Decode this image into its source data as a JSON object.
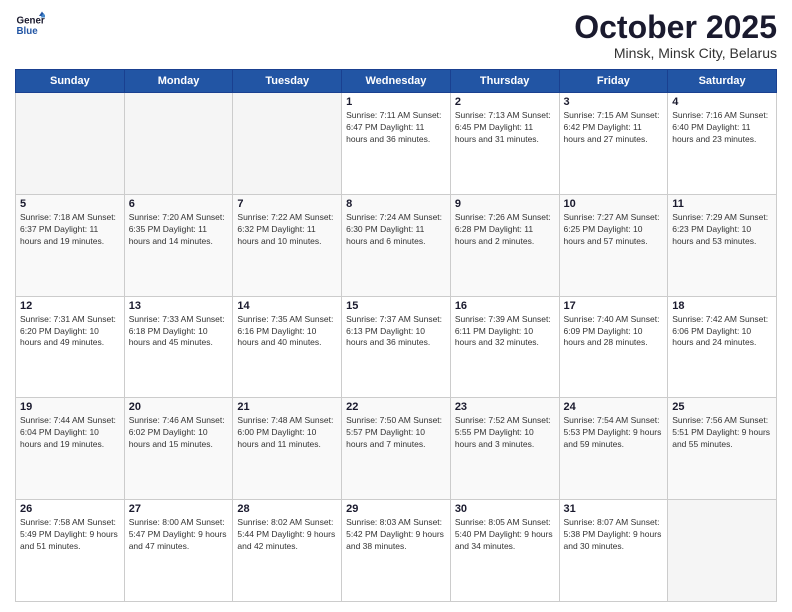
{
  "logo": {
    "line1": "General",
    "line2": "Blue"
  },
  "title": "October 2025",
  "location": "Minsk, Minsk City, Belarus",
  "days_of_week": [
    "Sunday",
    "Monday",
    "Tuesday",
    "Wednesday",
    "Thursday",
    "Friday",
    "Saturday"
  ],
  "weeks": [
    [
      {
        "day": "",
        "info": ""
      },
      {
        "day": "",
        "info": ""
      },
      {
        "day": "",
        "info": ""
      },
      {
        "day": "1",
        "info": "Sunrise: 7:11 AM\nSunset: 6:47 PM\nDaylight: 11 hours\nand 36 minutes."
      },
      {
        "day": "2",
        "info": "Sunrise: 7:13 AM\nSunset: 6:45 PM\nDaylight: 11 hours\nand 31 minutes."
      },
      {
        "day": "3",
        "info": "Sunrise: 7:15 AM\nSunset: 6:42 PM\nDaylight: 11 hours\nand 27 minutes."
      },
      {
        "day": "4",
        "info": "Sunrise: 7:16 AM\nSunset: 6:40 PM\nDaylight: 11 hours\nand 23 minutes."
      }
    ],
    [
      {
        "day": "5",
        "info": "Sunrise: 7:18 AM\nSunset: 6:37 PM\nDaylight: 11 hours\nand 19 minutes."
      },
      {
        "day": "6",
        "info": "Sunrise: 7:20 AM\nSunset: 6:35 PM\nDaylight: 11 hours\nand 14 minutes."
      },
      {
        "day": "7",
        "info": "Sunrise: 7:22 AM\nSunset: 6:32 PM\nDaylight: 11 hours\nand 10 minutes."
      },
      {
        "day": "8",
        "info": "Sunrise: 7:24 AM\nSunset: 6:30 PM\nDaylight: 11 hours\nand 6 minutes."
      },
      {
        "day": "9",
        "info": "Sunrise: 7:26 AM\nSunset: 6:28 PM\nDaylight: 11 hours\nand 2 minutes."
      },
      {
        "day": "10",
        "info": "Sunrise: 7:27 AM\nSunset: 6:25 PM\nDaylight: 10 hours\nand 57 minutes."
      },
      {
        "day": "11",
        "info": "Sunrise: 7:29 AM\nSunset: 6:23 PM\nDaylight: 10 hours\nand 53 minutes."
      }
    ],
    [
      {
        "day": "12",
        "info": "Sunrise: 7:31 AM\nSunset: 6:20 PM\nDaylight: 10 hours\nand 49 minutes."
      },
      {
        "day": "13",
        "info": "Sunrise: 7:33 AM\nSunset: 6:18 PM\nDaylight: 10 hours\nand 45 minutes."
      },
      {
        "day": "14",
        "info": "Sunrise: 7:35 AM\nSunset: 6:16 PM\nDaylight: 10 hours\nand 40 minutes."
      },
      {
        "day": "15",
        "info": "Sunrise: 7:37 AM\nSunset: 6:13 PM\nDaylight: 10 hours\nand 36 minutes."
      },
      {
        "day": "16",
        "info": "Sunrise: 7:39 AM\nSunset: 6:11 PM\nDaylight: 10 hours\nand 32 minutes."
      },
      {
        "day": "17",
        "info": "Sunrise: 7:40 AM\nSunset: 6:09 PM\nDaylight: 10 hours\nand 28 minutes."
      },
      {
        "day": "18",
        "info": "Sunrise: 7:42 AM\nSunset: 6:06 PM\nDaylight: 10 hours\nand 24 minutes."
      }
    ],
    [
      {
        "day": "19",
        "info": "Sunrise: 7:44 AM\nSunset: 6:04 PM\nDaylight: 10 hours\nand 19 minutes."
      },
      {
        "day": "20",
        "info": "Sunrise: 7:46 AM\nSunset: 6:02 PM\nDaylight: 10 hours\nand 15 minutes."
      },
      {
        "day": "21",
        "info": "Sunrise: 7:48 AM\nSunset: 6:00 PM\nDaylight: 10 hours\nand 11 minutes."
      },
      {
        "day": "22",
        "info": "Sunrise: 7:50 AM\nSunset: 5:57 PM\nDaylight: 10 hours\nand 7 minutes."
      },
      {
        "day": "23",
        "info": "Sunrise: 7:52 AM\nSunset: 5:55 PM\nDaylight: 10 hours\nand 3 minutes."
      },
      {
        "day": "24",
        "info": "Sunrise: 7:54 AM\nSunset: 5:53 PM\nDaylight: 9 hours\nand 59 minutes."
      },
      {
        "day": "25",
        "info": "Sunrise: 7:56 AM\nSunset: 5:51 PM\nDaylight: 9 hours\nand 55 minutes."
      }
    ],
    [
      {
        "day": "26",
        "info": "Sunrise: 7:58 AM\nSunset: 5:49 PM\nDaylight: 9 hours\nand 51 minutes."
      },
      {
        "day": "27",
        "info": "Sunrise: 8:00 AM\nSunset: 5:47 PM\nDaylight: 9 hours\nand 47 minutes."
      },
      {
        "day": "28",
        "info": "Sunrise: 8:02 AM\nSunset: 5:44 PM\nDaylight: 9 hours\nand 42 minutes."
      },
      {
        "day": "29",
        "info": "Sunrise: 8:03 AM\nSunset: 5:42 PM\nDaylight: 9 hours\nand 38 minutes."
      },
      {
        "day": "30",
        "info": "Sunrise: 8:05 AM\nSunset: 5:40 PM\nDaylight: 9 hours\nand 34 minutes."
      },
      {
        "day": "31",
        "info": "Sunrise: 8:07 AM\nSunset: 5:38 PM\nDaylight: 9 hours\nand 30 minutes."
      },
      {
        "day": "",
        "info": ""
      }
    ]
  ]
}
